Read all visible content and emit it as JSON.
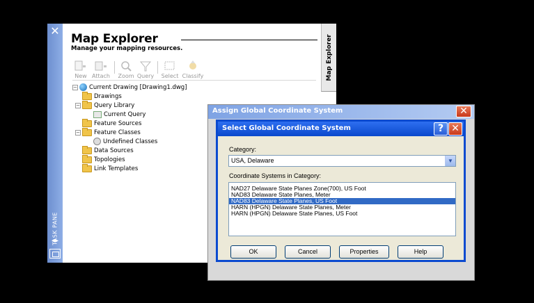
{
  "task_pane": {
    "vertical_label": "TASK PANE",
    "side_tab": "Map Explorer",
    "title": "Map Explorer",
    "subtitle": "Manage your mapping resources.",
    "toolbar": [
      {
        "label": "New",
        "icon": "new-icon"
      },
      {
        "label": "Attach",
        "icon": "attach-icon"
      },
      {
        "label": "Zoom",
        "icon": "zoom-icon"
      },
      {
        "label": "Query",
        "icon": "query-icon"
      },
      {
        "label": "Select",
        "icon": "select-icon"
      },
      {
        "label": "Classify",
        "icon": "classify-icon"
      }
    ],
    "tree": [
      {
        "label": "Current Drawing [Drawing1.dwg]",
        "icon": "globe-icon"
      },
      {
        "label": "Drawings",
        "icon": "folder-icon"
      },
      {
        "label": "Query Library",
        "icon": "folder-icon"
      },
      {
        "label": "Current Query",
        "icon": "query-icon"
      },
      {
        "label": "Feature Sources",
        "icon": "folder-icon"
      },
      {
        "label": "Feature Classes",
        "icon": "folder-icon"
      },
      {
        "label": "Undefined Classes",
        "icon": "undefined-class-icon"
      },
      {
        "label": "Data Sources",
        "icon": "folder-icon"
      },
      {
        "label": "Topologies",
        "icon": "folder-icon"
      },
      {
        "label": "Link Templates",
        "icon": "folder-icon"
      }
    ]
  },
  "outer_dialog": {
    "title": "Assign Global Coordinate System"
  },
  "inner_dialog": {
    "title": "Select Global Coordinate System",
    "category_label": "Category:",
    "category_value": "USA, Delaware",
    "systems_label": "Coordinate Systems in Category:",
    "systems": [
      "NAD27 Delaware State Planes Zone(700), US Foot",
      "NAD83 Delaware State Planes, Meter",
      "NAD83 Delaware State Planes, US Foot",
      "HARN (HPGN) Delaware State Planes, Meter",
      "HARN (HPGN) Delaware State Planes, US Foot"
    ],
    "selected_index": 2,
    "buttons": {
      "ok": "OK",
      "cancel": "Cancel",
      "properties": "Properties",
      "help": "Help"
    }
  },
  "colors": {
    "task_strip": "#7b9ad8",
    "dialog_title_active": "#0a48cc",
    "selection": "#316ac5"
  }
}
